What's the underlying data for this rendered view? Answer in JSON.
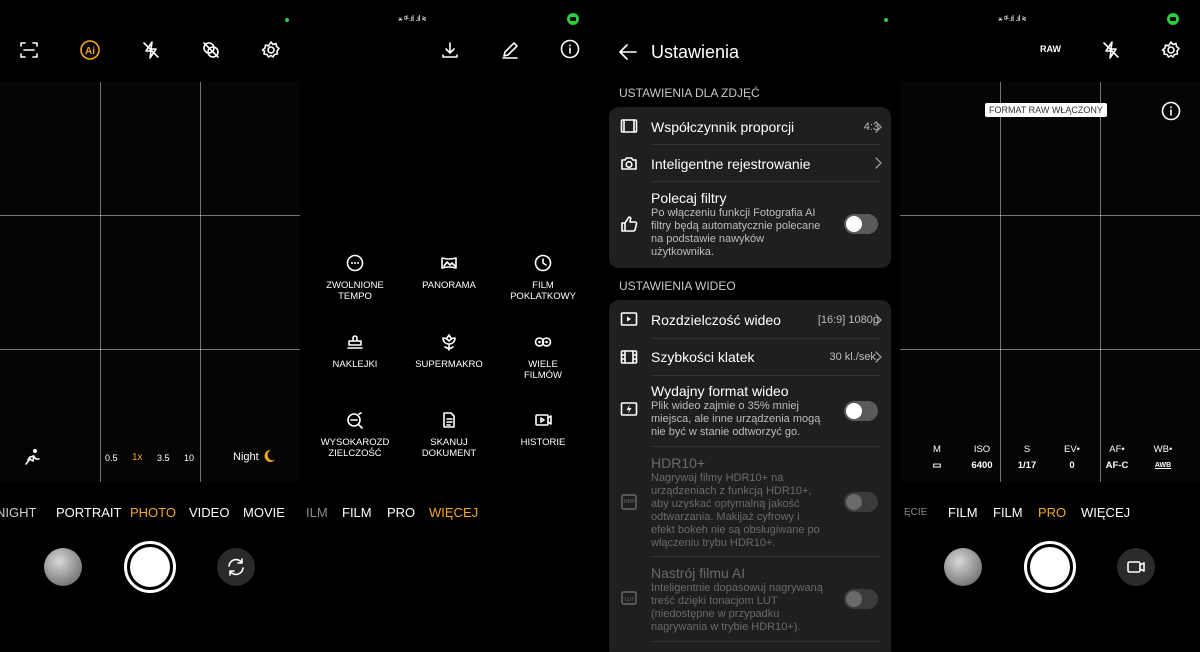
{
  "panel1": {
    "zoom_levels": [
      "0.5",
      "1x",
      "3.5",
      "10"
    ],
    "night_label": "Night",
    "modes": [
      "NIGHT",
      "PORTRAIT",
      "PHOTO",
      "VIDEO",
      "MOVIE"
    ],
    "active_mode": "PHOTO",
    "icons": [
      "scan-icon",
      "ai-icon",
      "flash-off-icon",
      "filter-icon",
      "settings-icon",
      "motion-icon",
      "switch-camera-icon"
    ]
  },
  "panel2": {
    "status": "⚹ ᵍᴸ.ıl .ıl ≋",
    "more_modes": [
      {
        "label": "ZWOLNIONE\nTEMPO"
      },
      {
        "label": "PANORAMA"
      },
      {
        "label": "FILM\nPOKLATKOWY"
      },
      {
        "label": "NAKLEJKI"
      },
      {
        "label": "SUPERMAKRO"
      },
      {
        "label": "WIELE\nFILMÓW"
      },
      {
        "label": "WYSOKAROZD\nZIELCZOŚĆ"
      },
      {
        "label": "SKANUJ\nDOKUMENT"
      },
      {
        "label": "HISTORIE"
      }
    ],
    "modes": [
      "ILM",
      "FILM",
      "PRO",
      "WIĘCEJ"
    ],
    "active_mode": "WIĘCEJ"
  },
  "panel3": {
    "title": "Ustawienia",
    "photo_section": "USTAWIENIA DLA ZDJĘĆ",
    "video_section": "USTAWIENIA WIDEO",
    "aspect_title": "Współczynnik proporcji",
    "aspect_value": "4:3",
    "smart_title": "Inteligentne rejestrowanie",
    "filters_title": "Polecaj filtry",
    "filters_sub": "Po włączeniu funkcji Fotografia AI filtry będą automatycznie polecane na podstawie nawyków użytkownika.",
    "resolution_title": "Rozdzielczość wideo",
    "resolution_value": "[16:9] 1080p",
    "fps_title": "Szybkości klatek",
    "fps_value": "30 kl./sek.",
    "efficient_title": "Wydajny format wideo",
    "efficient_sub": "Plik wideo zajmie o 35% mniej miejsca, ale inne urządzenia mogą nie być w stanie odtworzyć go.",
    "hdr_title": "HDR10+",
    "hdr_sub": "Nagrywaj filmy HDR10+ na urządzeniach z funkcją HDR10+, aby uzyskać optymalną jakość odtwarzania. Makijaż cyfrowy i efekt bokeh nie są obsługiwane po włączeniu trybu HDR10+.",
    "mood_title": "Nastrój filmu AI",
    "mood_sub": "Inteligentnie dopasowuj nagrywaną treść dzięki tonacjom LUT (niedostępne w przypadku nagrywania w trybie HDR10+)."
  },
  "panel4": {
    "status": "⚹ ᵍᴸ.ıl .ıl ≋",
    "raw_label": "RAW",
    "raw_toast": "FORMAT RAW WŁĄCZONY",
    "pro_params": [
      {
        "name": "M",
        "value": "▭"
      },
      {
        "name": "ISO",
        "value": "6400"
      },
      {
        "name": "S",
        "value": "1/17"
      },
      {
        "name": "EV•",
        "value": "0"
      },
      {
        "name": "AF•",
        "value": "AF-C"
      },
      {
        "name": "WB•",
        "value": "AWB"
      }
    ],
    "modes": [
      "ĘCIE",
      "FILM",
      "FILM",
      "PRO",
      "WIĘCEJ"
    ],
    "active_mode": "PRO"
  },
  "colors": {
    "accent": "#f5a623",
    "card": "#1f1f1f",
    "status_green": "#2ecc40"
  }
}
